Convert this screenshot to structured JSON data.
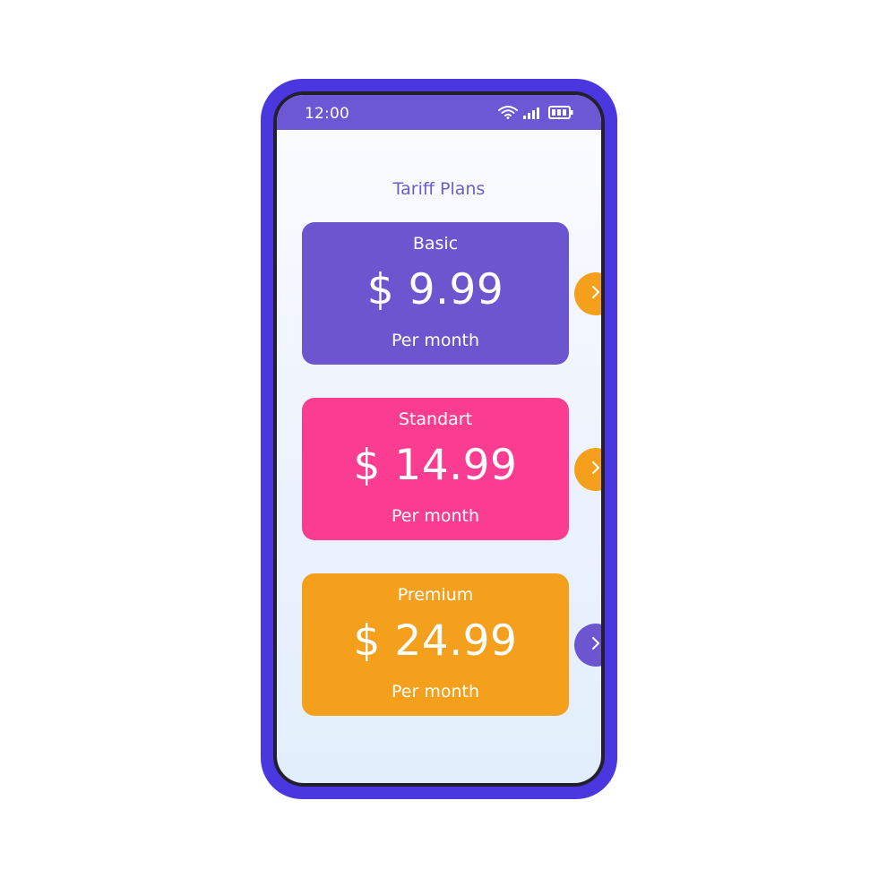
{
  "status_bar": {
    "time": "12:00",
    "icons": [
      "wifi-icon",
      "signal-icon",
      "battery-icon"
    ]
  },
  "page": {
    "title": "Tariff Plans"
  },
  "plans": [
    {
      "name": "Basic",
      "price": "$ 9.99",
      "period": "Per month",
      "card_color": "#6b56d0",
      "button_color": "#f5a01c"
    },
    {
      "name": "Standart",
      "price": "$ 14.99",
      "period": "Per month",
      "card_color": "#fb3d91",
      "button_color": "#f5a01c"
    },
    {
      "name": "Premium",
      "price": "$ 24.99",
      "period": "Per month",
      "card_color": "#f5a01c",
      "button_color": "#6b56d0"
    }
  ],
  "colors": {
    "phone_frame": "#4b37e0",
    "status_bar": "#6c58d4",
    "title_text": "#6a5fc8"
  }
}
